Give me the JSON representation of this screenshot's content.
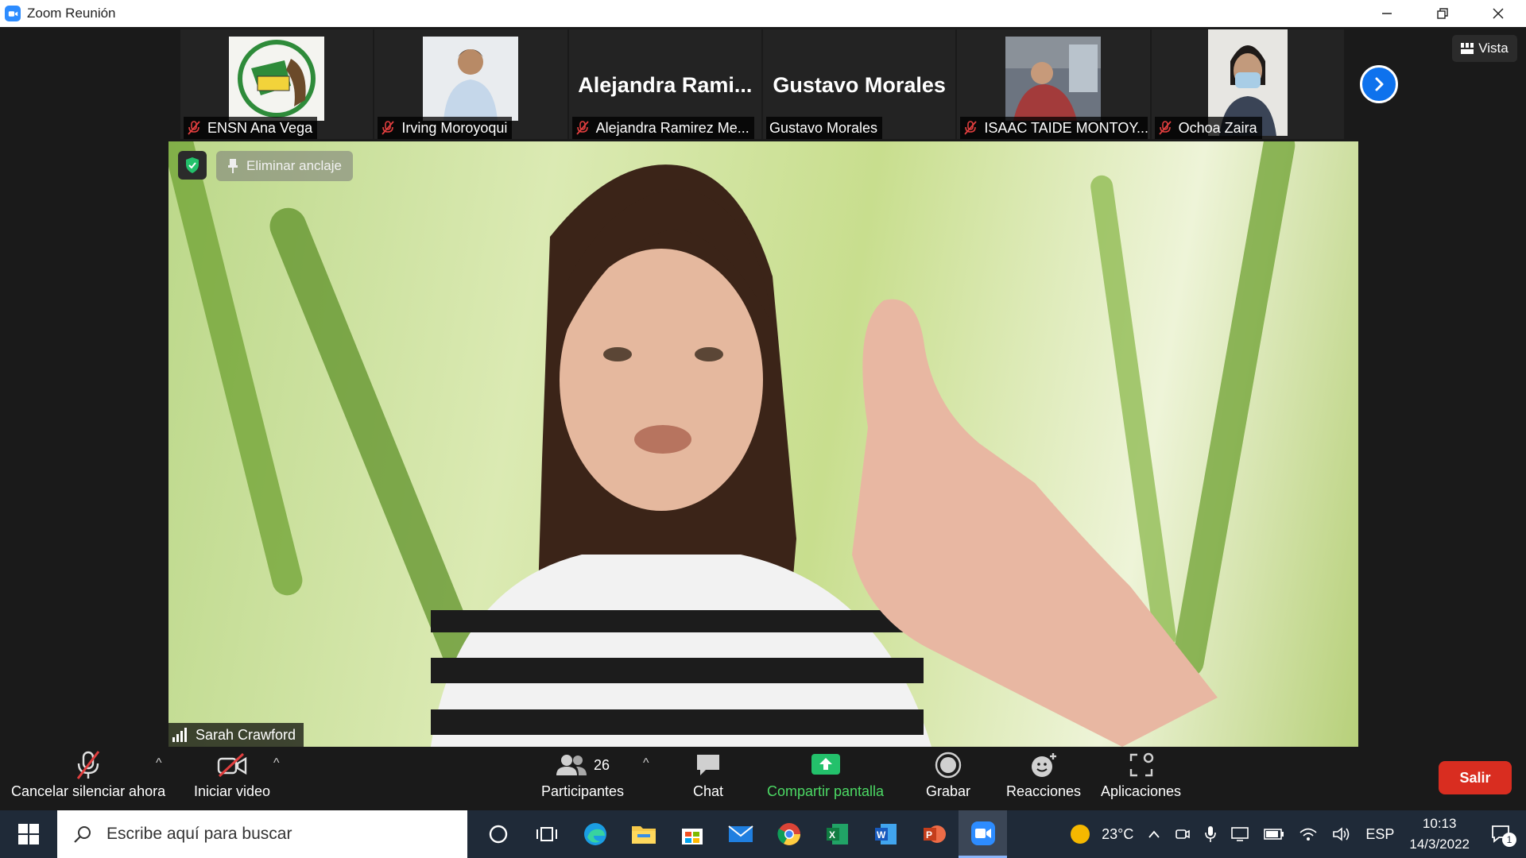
{
  "window": {
    "title": "Zoom Reunión"
  },
  "participants_strip": [
    {
      "name": "ENSN Ana Vega",
      "display": "photo",
      "muted": true
    },
    {
      "name": "Irving Moroyoqui",
      "display": "photo",
      "muted": true
    },
    {
      "name": "Alejandra Ramirez Me...",
      "display": "text",
      "big_name": "Alejandra  Rami...",
      "muted": true
    },
    {
      "name": "Gustavo Morales",
      "display": "text",
      "big_name": "Gustavo Morales",
      "muted": false
    },
    {
      "name": "ISAAC TAIDE MONTOY...",
      "display": "photo",
      "muted": true
    },
    {
      "name": "Ochoa Zaira",
      "display": "photo",
      "muted": true
    }
  ],
  "view_button": {
    "label": "Vista"
  },
  "main_video": {
    "speaker_name": "Sarah Crawford",
    "unpin_label": "Eliminar anclaje"
  },
  "toolbar": {
    "unmute_label": "Cancelar silenciar ahora",
    "video_label": "Iniciar video",
    "participants_label": "Participantes",
    "participants_count": "26",
    "chat_label": "Chat",
    "share_label": "Compartir pantalla",
    "record_label": "Grabar",
    "reactions_label": "Reacciones",
    "apps_label": "Aplicaciones",
    "exit_label": "Salir"
  },
  "taskbar": {
    "search_placeholder": "Escribe aquí para buscar",
    "temperature": "23°C",
    "language": "ESP",
    "time": "10:13",
    "date": "14/3/2022",
    "notifications": "1"
  },
  "colors": {
    "accent": "#0e72ed",
    "share_green": "#4cd964",
    "exit_red": "#d92d20"
  }
}
